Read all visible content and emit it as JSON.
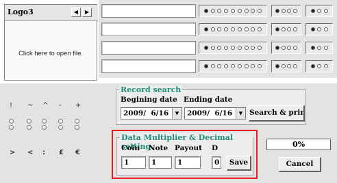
{
  "logo": {
    "tab_label": "Logo3",
    "prev_icon": "triangle-left",
    "next_icon": "triangle-right",
    "open_text": "Click here to open file."
  },
  "fields": [
    {
      "value": ""
    },
    {
      "value": ""
    },
    {
      "value": ""
    },
    {
      "value": ""
    }
  ],
  "radio_groups": [
    {
      "dots": [
        1,
        0,
        0,
        0,
        0,
        0,
        0,
        0,
        0
      ],
      "small_a": [
        1,
        0,
        0,
        0
      ],
      "small_b": [
        1,
        0,
        0
      ]
    },
    {
      "dots": [
        1,
        0,
        0,
        0,
        0,
        0,
        0,
        0,
        0
      ],
      "small_a": [
        1,
        0,
        0,
        0
      ],
      "small_b": [
        1,
        0,
        0
      ]
    },
    {
      "dots": [
        1,
        0,
        0,
        0,
        0,
        0,
        0,
        0,
        0
      ],
      "small_a": [
        1,
        0,
        0,
        0
      ],
      "small_b": [
        1,
        0,
        0
      ]
    },
    {
      "dots": [
        1,
        0,
        0,
        0,
        0,
        0,
        0,
        0,
        0
      ],
      "small_a": [
        1,
        0,
        0,
        0
      ],
      "small_b": [
        1,
        0,
        0
      ]
    }
  ],
  "symbols": {
    "row1": [
      "!",
      "~",
      "^",
      "-",
      "+"
    ],
    "row2": [
      ">",
      "<",
      ":",
      "£",
      "€"
    ]
  },
  "record_search": {
    "title": "Record search",
    "begin_label": "Begining date",
    "end_label": "Ending date",
    "begin_value": "2009/  6/16",
    "end_value": "2009/  6/16",
    "search_button": "Search & print"
  },
  "multiplier": {
    "title": "Data Multiplier  &  Decimal setting",
    "coin_label": "Coin",
    "note_label": "Note",
    "payout_label": "Payout",
    "d_label": "D",
    "coin_value": "1",
    "note_value": "1",
    "payout_value": "1",
    "d_value": "0",
    "save_button": "Save"
  },
  "progress": {
    "value": 0,
    "text": "0%"
  },
  "cancel_button": "Cancel",
  "colors": {
    "group_title": "#1e8f7a",
    "highlight_frame": "#e02020",
    "panel_gray": "#e3e3e3"
  }
}
